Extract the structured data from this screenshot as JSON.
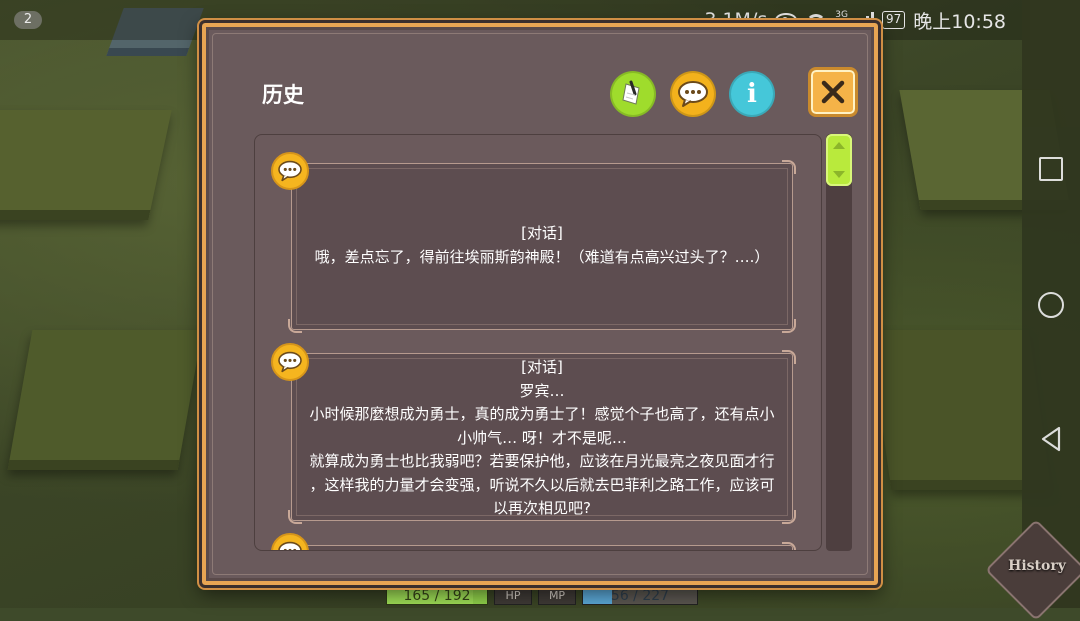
{
  "status_bar": {
    "notification_count": "2",
    "net_speed": "3.1M/s",
    "network_type_top": "3G",
    "network_type_bottom": "2G",
    "battery": "97",
    "time": "晚上10:58"
  },
  "dialog": {
    "title": "历史",
    "entries": [
      {
        "tag": "[对话]",
        "lines": [
          "哦，差点忘了，得前往埃丽斯韵神殿！（难道有点高兴过头了？….）"
        ]
      },
      {
        "tag": "[对话]",
        "lines": [
          "罗宾…",
          "小时候那麼想成为勇士，真的成为勇士了！感觉个子也高了，还有点小",
          "小帅气… 呀！才不是呢…",
          "就算成为勇士也比我弱吧？若要保护他，应该在月光最亮之夜见面才行",
          "，这样我的力量才会变强，听说不久以后就去巴菲利之路工作，应该可",
          "以再次相见吧?"
        ]
      }
    ],
    "scroll_fraction": 0.0
  },
  "hud": {
    "hp_text": "165 / 192",
    "hp_fraction": 0.86,
    "hp_label": "HP",
    "mp_label": "MP",
    "mp_text": "56 / 227",
    "mp_fraction": 0.25
  },
  "side_button": {
    "label": "History"
  },
  "colors": {
    "dialog_bg": "#6a5a5c",
    "dialog_border": "#e8a553",
    "note_button": "#9fdc2c",
    "chat_button": "#f3b21c",
    "info_button": "#45c7d9",
    "close_button": "#f5b348",
    "scroll_thumb": "#b9ea3c"
  },
  "icons": {
    "note_button": "note-paper-icon",
    "chat_button": "speech-bubble-icon",
    "info_button": "info-icon",
    "close_button": "close-x-icon",
    "entry_badge": "speech-bubble-icon"
  }
}
